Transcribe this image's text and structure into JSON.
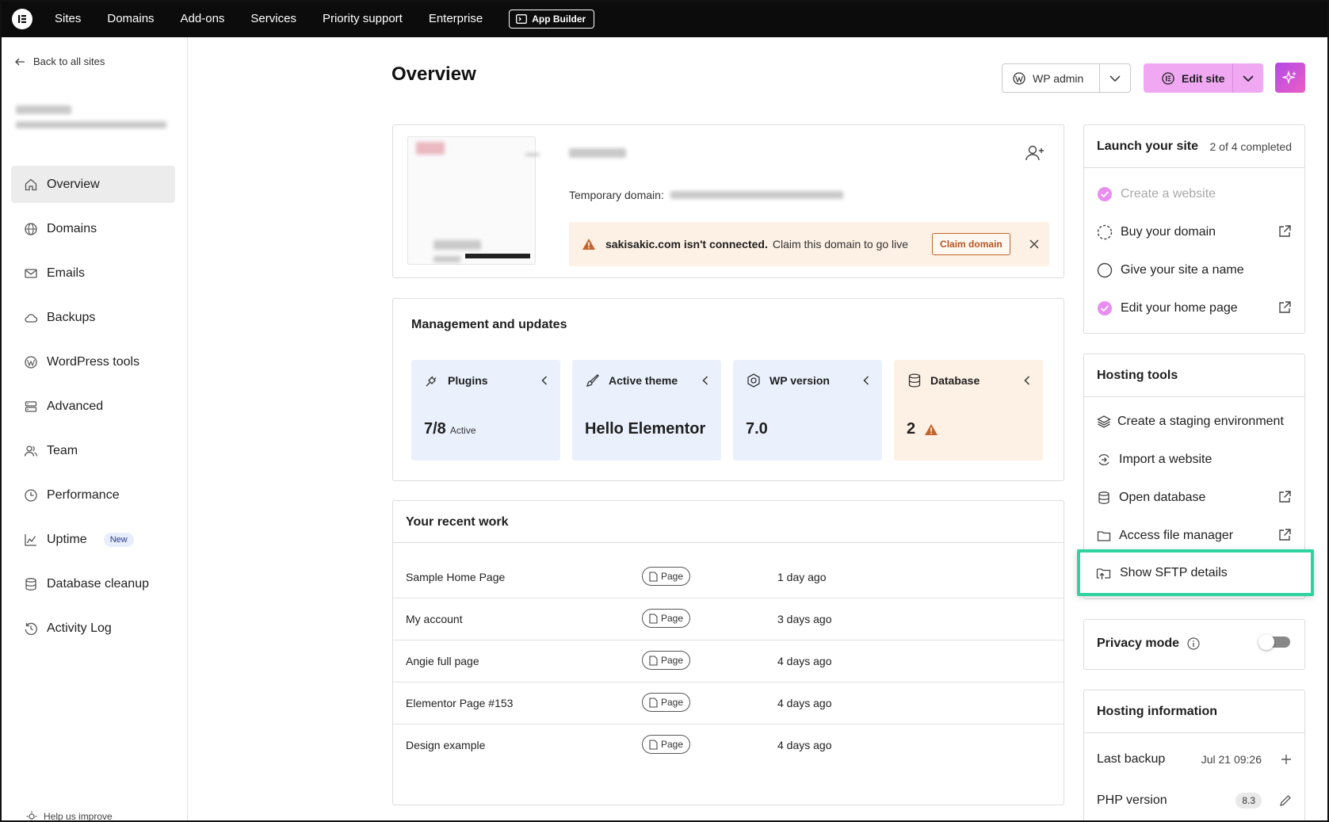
{
  "topnav": {
    "items": [
      "Sites",
      "Domains",
      "Add-ons",
      "Services",
      "Priority support",
      "Enterprise"
    ],
    "app_builder": "App Builder"
  },
  "sidebar": {
    "back_label": "Back to all sites",
    "items": [
      {
        "label": "Overview",
        "icon": "home-icon",
        "active": true
      },
      {
        "label": "Domains",
        "icon": "globe-icon"
      },
      {
        "label": "Emails",
        "icon": "mail-icon"
      },
      {
        "label": "Backups",
        "icon": "cloud-icon"
      },
      {
        "label": "WordPress tools",
        "icon": "wordpress-icon"
      },
      {
        "label": "Advanced",
        "icon": "server-icon"
      },
      {
        "label": "Team",
        "icon": "team-icon"
      },
      {
        "label": "Performance",
        "icon": "clock-icon"
      },
      {
        "label": "Uptime",
        "icon": "chart-icon",
        "badge": "New"
      },
      {
        "label": "Database cleanup",
        "icon": "database-icon"
      },
      {
        "label": "Activity Log",
        "icon": "history-icon"
      }
    ],
    "help_label": "Help us improve"
  },
  "header": {
    "title": "Overview",
    "wp_admin": "WP admin",
    "edit_site": "Edit site"
  },
  "site_card": {
    "temp_domain_label": "Temporary domain:",
    "alert_domain": "sakisakic.com isn't connected.",
    "alert_text": "Claim this domain to go live",
    "claim_button": "Claim domain"
  },
  "management": {
    "title": "Management and updates",
    "stats": [
      {
        "label": "Plugins",
        "value": "7/8",
        "suffix": "Active",
        "icon": "plug-icon"
      },
      {
        "label": "Active theme",
        "value": "Hello Elementor",
        "icon": "brush-icon"
      },
      {
        "label": "WP version",
        "value": "7.0",
        "icon": "hexagon-icon"
      },
      {
        "label": "Database",
        "value": "2",
        "icon": "database-icon",
        "warning": true
      }
    ]
  },
  "recent_work": {
    "title": "Your recent work",
    "rows": [
      {
        "name": "Sample Home Page",
        "type": "Page",
        "time": "1 day ago"
      },
      {
        "name": "My account",
        "type": "Page",
        "time": "3 days ago"
      },
      {
        "name": "Angie full page",
        "type": "Page",
        "time": "4 days ago"
      },
      {
        "name": "Elementor Page #153",
        "type": "Page",
        "time": "4 days ago"
      },
      {
        "name": "Design example",
        "type": "Page",
        "time": "4 days ago"
      }
    ]
  },
  "launch": {
    "title": "Launch your site",
    "progress": "2 of 4 completed",
    "completed": 2,
    "total": 4,
    "items": [
      {
        "label": "Create a website",
        "done": true,
        "external": false
      },
      {
        "label": "Buy your domain",
        "done": false,
        "pending": true,
        "external": true
      },
      {
        "label": "Give your site a name",
        "done": false,
        "external": false
      },
      {
        "label": "Edit your home page",
        "done": true,
        "external": true
      }
    ]
  },
  "hosting_tools": {
    "title": "Hosting tools",
    "items": [
      {
        "label": "Create a staging environment",
        "icon": "layers-icon",
        "external": false
      },
      {
        "label": "Import a website",
        "icon": "import-icon",
        "external": false
      },
      {
        "label": "Open database",
        "icon": "database-icon",
        "external": true
      },
      {
        "label": "Access file manager",
        "icon": "folder-icon",
        "external": true
      },
      {
        "label": "Show SFTP details",
        "icon": "folder-upload-icon",
        "external": false,
        "highlighted": true
      }
    ]
  },
  "privacy": {
    "title": "Privacy mode",
    "enabled": false
  },
  "hosting_info": {
    "title": "Hosting information",
    "last_backup_label": "Last backup",
    "last_backup_value": "Jul 21 09:26",
    "php_label": "PHP version",
    "php_value": "8.3"
  },
  "colors": {
    "topbar": "#0c0c0c",
    "accent_pink": "#f0a8f3",
    "highlight": "#2fd3a0",
    "stat_blue": "#eaf1fd",
    "warn_bg": "#fdf0e4",
    "warn_icon": "#b45523"
  }
}
